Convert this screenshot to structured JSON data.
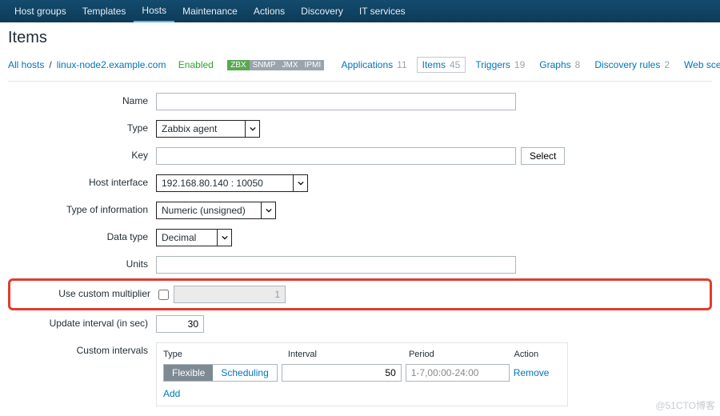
{
  "nav": {
    "items": [
      "Host groups",
      "Templates",
      "Hosts",
      "Maintenance",
      "Actions",
      "Discovery",
      "IT services"
    ],
    "activeIndex": 2
  },
  "page": {
    "title": "Items"
  },
  "breadcrumb": {
    "allhosts": "All hosts",
    "host": "linux-node2.example.com",
    "enabled": "Enabled",
    "badges": [
      "ZBX",
      "SNMP",
      "JMX",
      "IPMI"
    ],
    "tabs": [
      {
        "label": "Applications",
        "count": "11"
      },
      {
        "label": "Items",
        "count": "45",
        "active": true
      },
      {
        "label": "Triggers",
        "count": "19"
      },
      {
        "label": "Graphs",
        "count": "8"
      },
      {
        "label": "Discovery rules",
        "count": "2"
      },
      {
        "label": "Web sce"
      }
    ]
  },
  "form": {
    "name": {
      "label": "Name",
      "value": ""
    },
    "type": {
      "label": "Type",
      "value": "Zabbix agent"
    },
    "key": {
      "label": "Key",
      "value": "",
      "selectBtn": "Select"
    },
    "hostif": {
      "label": "Host interface",
      "value": "192.168.80.140 : 10050"
    },
    "typeinfo": {
      "label": "Type of information",
      "value": "Numeric (unsigned)"
    },
    "datatype": {
      "label": "Data type",
      "value": "Decimal"
    },
    "units": {
      "label": "Units",
      "value": ""
    },
    "custmult": {
      "label": "Use custom multiplier",
      "value": "1"
    },
    "updint": {
      "label": "Update interval (in sec)",
      "value": "30"
    },
    "custint": {
      "label": "Custom intervals",
      "headers": {
        "type": "Type",
        "interval": "Interval",
        "period": "Period",
        "action": "Action"
      },
      "seg": {
        "flexible": "Flexible",
        "scheduling": "Scheduling"
      },
      "row": {
        "interval": "50",
        "period": "1-7,00:00-24:00",
        "remove": "Remove"
      },
      "add": "Add"
    }
  },
  "watermark": "@51CTO博客"
}
